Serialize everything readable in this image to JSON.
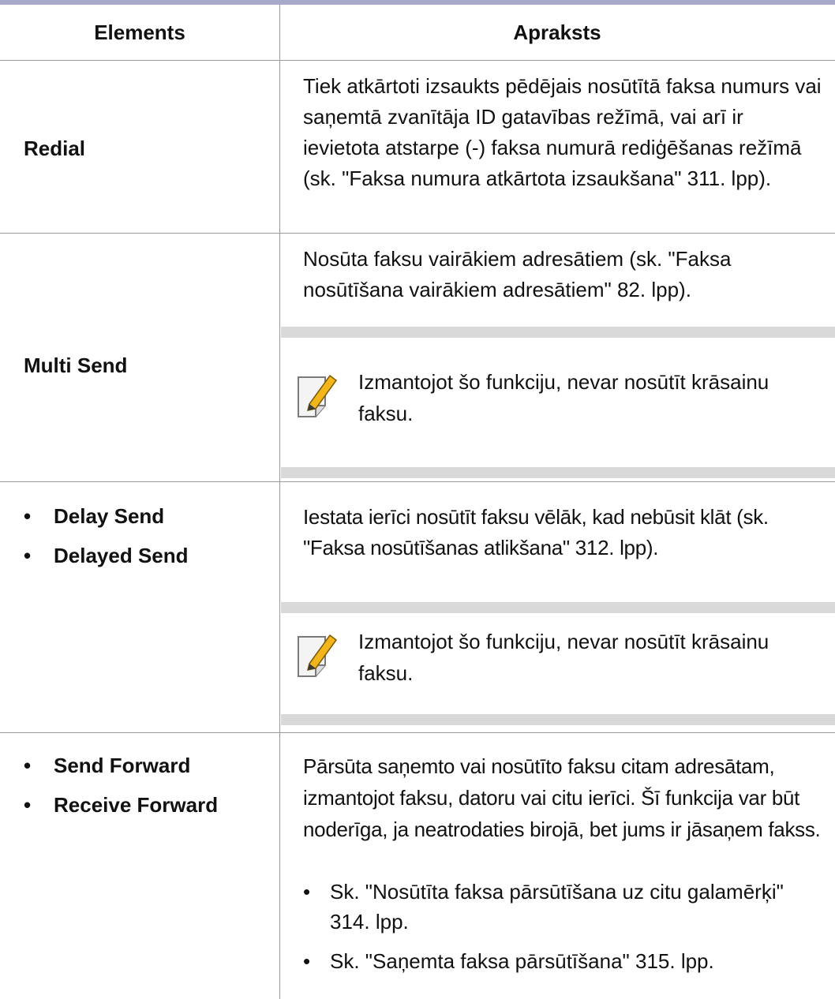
{
  "table": {
    "header_left": "Elements",
    "header_right": "Apraksts",
    "rows": [
      {
        "element": "Redial",
        "description": "Tiek atkārtoti izsaukts pēdējais nosūtītā faksa numurs vai saņemtā zvanītāja ID gatavības režīmā, vai arī ir ievietota atstarpe (-) faksa numurā rediģēšanas režīmā (sk. \"Faksa numura atkārtota izsaukšana\" 311. lpp)."
      },
      {
        "element": "Multi Send",
        "description": "Nosūta faksu vairākiem adresātiem (sk. \"Faksa nosūtīšana vairākiem adresātiem\" 82. lpp).",
        "note": "Izmantojot šo funkciju, nevar nosūtīt krāsainu faksu.",
        "note_icon": "pencil-note-icon"
      },
      {
        "elements": [
          "Delay Send",
          "Delayed Send"
        ],
        "description": "Iestata ierīci nosūtīt faksu vēlāk, kad nebūsit klāt (sk. \"Faksa nosūtīšanas atlikšana\" 312. lpp).",
        "note": "Izmantojot šo funkciju, nevar nosūtīt krāsainu faksu.",
        "note_icon": "pencil-note-icon"
      },
      {
        "elements": [
          "Send Forward",
          "Receive Forward"
        ],
        "description": "Pārsūta saņemto vai nosūtīto faksu citam adresātam, izmantojot faksu, datoru vai citu ierīci. Šī funkcija var būt noderīga, ja neatrodaties birojā, bet jums ir jāsaņem fakss.",
        "bullets": [
          "Sk. \"Nosūtīta faksa pārsūtīšana uz citu galamērķi\" 314. lpp.",
          "Sk. \"Saņemta faksa pārsūtīšana\" 315. lpp."
        ]
      }
    ]
  },
  "bullet_glyph": "•",
  "colors": {
    "rule": "#a8a8c8",
    "note_band": "#d9d9d9",
    "border": "#9a9a9a"
  }
}
